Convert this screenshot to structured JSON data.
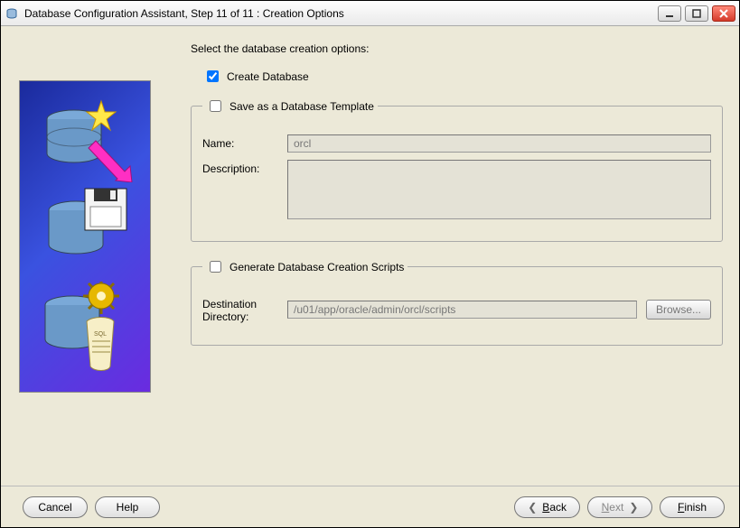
{
  "window": {
    "title": "Database Configuration Assistant, Step 11 of 11 : Creation Options"
  },
  "main": {
    "heading": "Select the database creation options:",
    "create_db_label": "Create Database",
    "create_db_checked": true,
    "template": {
      "legend": "Save as a Database Template",
      "checked": false,
      "name_label": "Name:",
      "name_value": "orcl",
      "desc_label": "Description:",
      "desc_value": ""
    },
    "scripts": {
      "legend": "Generate Database Creation Scripts",
      "checked": false,
      "dest_label": "Destination Directory:",
      "dest_value": "/u01/app/oracle/admin/orcl/scripts",
      "browse_label": "Browse..."
    }
  },
  "footer": {
    "cancel": "Cancel",
    "help": "Help",
    "back_prefix": "B",
    "back_rest": "ack",
    "next_prefix": "N",
    "next_rest": "ext",
    "finish_prefix": "F",
    "finish_rest": "inish"
  }
}
